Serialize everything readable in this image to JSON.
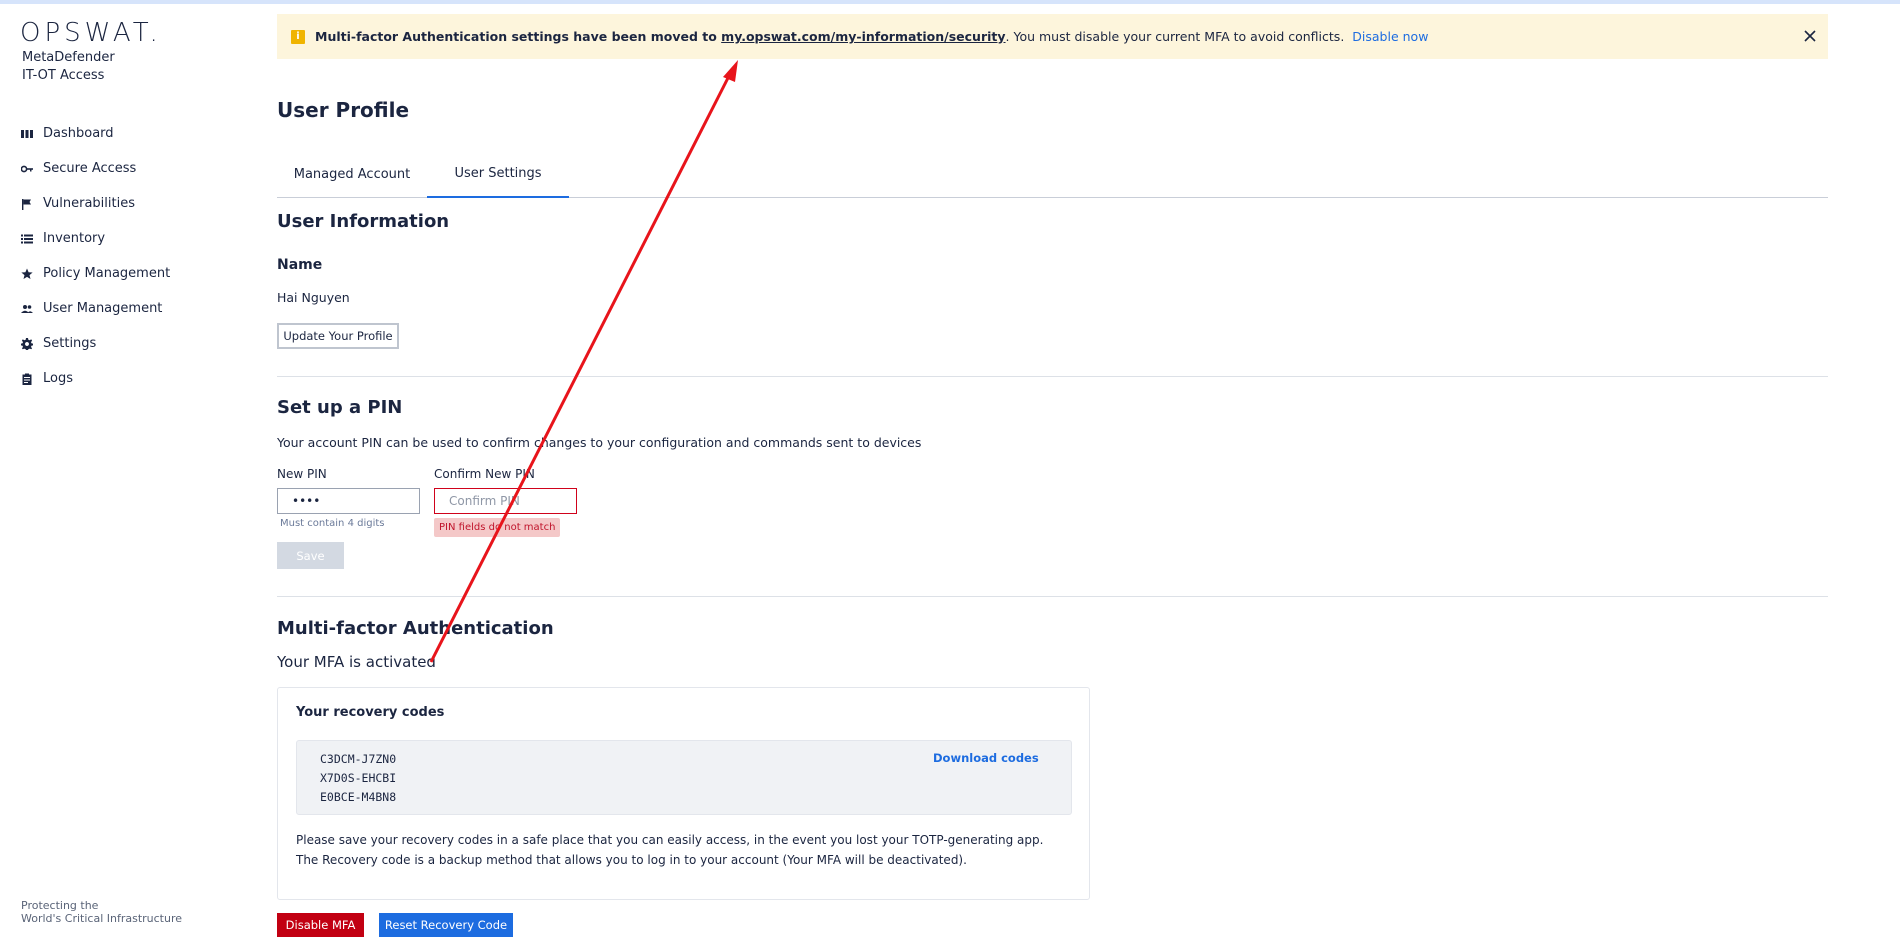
{
  "app": {
    "logo": "OPSWAT.",
    "product_line1": "MetaDefender",
    "product_line2": "IT-OT Access",
    "tagline_line1": "Protecting the",
    "tagline_line2": "World's Critical Infrastructure"
  },
  "sidebar": {
    "items": [
      {
        "label": "Dashboard",
        "icon": "dashboard-icon"
      },
      {
        "label": "Secure Access",
        "icon": "key-icon"
      },
      {
        "label": "Vulnerabilities",
        "icon": "flag-icon"
      },
      {
        "label": "Inventory",
        "icon": "list-icon"
      },
      {
        "label": "Policy Management",
        "icon": "star-icon"
      },
      {
        "label": "User Management",
        "icon": "users-icon"
      },
      {
        "label": "Settings",
        "icon": "gear-icon"
      },
      {
        "label": "Logs",
        "icon": "clipboard-icon"
      }
    ]
  },
  "banner": {
    "text_start": "Multi-factor Authentication settings have been moved to ",
    "link": "my.opswat.com/my-information/security",
    "text_end": ". You must disable your current MFA to avoid conflicts.",
    "action": "Disable now"
  },
  "page": {
    "title": "User Profile",
    "tabs": [
      "Managed Account",
      "User Settings"
    ],
    "active_tab": "User Settings"
  },
  "user_info": {
    "heading": "User Information",
    "name_label": "Name",
    "name_value": "Hai Nguyen",
    "update_button": "Update Your Profile"
  },
  "pin": {
    "heading": "Set up a PIN",
    "description": "Your account PIN can be used to confirm changes to your configuration and commands sent to devices",
    "new_label": "New PIN",
    "new_value": "••••",
    "new_hint": "Must contain 4 digits",
    "confirm_label": "Confirm New PIN",
    "confirm_placeholder": "Confirm PIN",
    "error": "PIN fields do not match",
    "save_button": "Save"
  },
  "mfa": {
    "heading": "Multi-factor Authentication",
    "status": "Your MFA is activated",
    "card_title": "Your recovery codes",
    "codes": [
      "C3DCM-J7ZN0",
      "X7D0S-EHCBI",
      "E0BCE-M4BN8"
    ],
    "download": "Download codes",
    "note": "Please save your recovery codes in a safe place that you can easily access, in the event you lost your TOTP-generating app. The Recovery code is a backup method that allows you to log in to your account (Your MFA will be deactivated).",
    "disable_button": "Disable MFA",
    "reset_button": "Reset Recovery Code"
  },
  "colors": {
    "accent": "#1d6ce0",
    "danger": "#c20012",
    "banner_bg": "#fdf5dc",
    "annotation_arrow": "#e8141b"
  }
}
